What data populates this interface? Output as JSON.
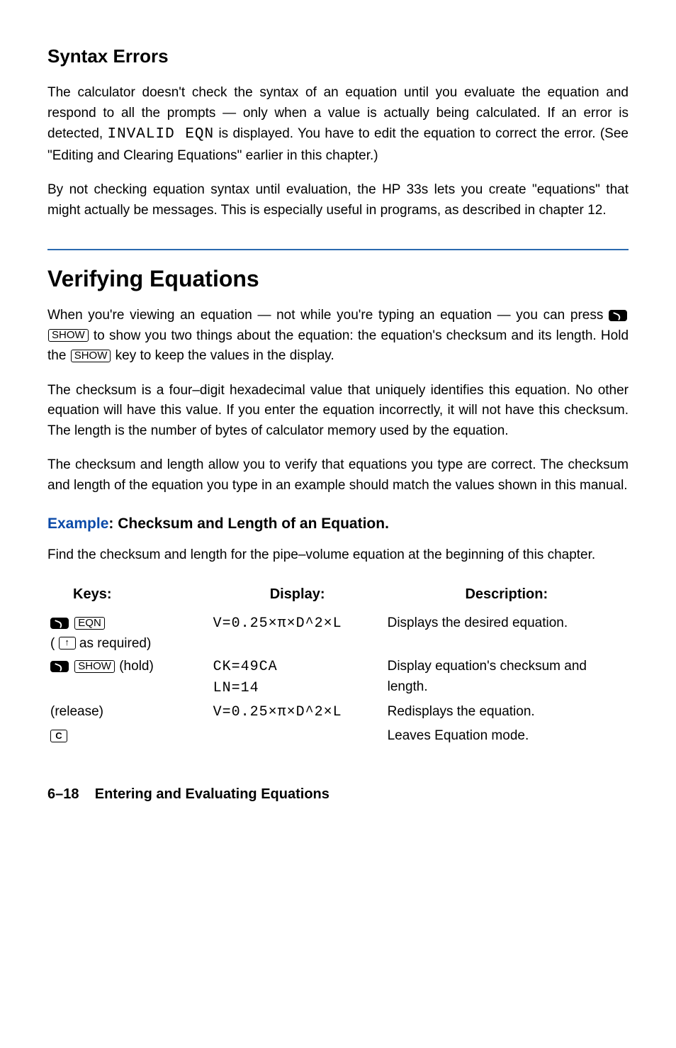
{
  "section1": {
    "title": "Syntax Errors",
    "p1_a": "The calculator doesn't check the syntax of an equation until you evaluate the equation and respond to all the prompts — only when a value is actually being calculated. If an error is detected, ",
    "p1_code": "INVALID EQN",
    "p1_b": " is displayed. You have to edit the equation to correct the error. (See \"Editing and Clearing Equations\" earlier in this chapter.)",
    "p2": "By not checking equation syntax until evaluation, the HP 33s lets you create \"equations\" that might actually be messages. This is especially useful in programs, as described in chapter 12."
  },
  "section2": {
    "title": "Verifying Equations",
    "p1_a": "When you're viewing an equation — not while you're typing an equation — you can press ",
    "show_label": "SHOW",
    "p1_b": " to show you two things about the equation: the equation's checksum and its length. Hold the ",
    "p1_c": " key to keep the values in the display.",
    "p2": "The checksum is a four–digit hexadecimal value that uniquely identifies this equation. No other equation will have this value. If you enter the equation incorrectly, it will not have this checksum. The length is the number of bytes of calculator memory used by the equation.",
    "p3": "The checksum and length allow you to verify that equations you type are correct. The checksum and length of the equation you type in an example should match the values shown in this manual."
  },
  "example": {
    "lead": "Example",
    "title": ": Checksum and Length of an Equation.",
    "intro": "Find the checksum and length for the pipe–volume equation at the beginning of this chapter.",
    "headers": {
      "keys": "Keys:",
      "display": "Display:",
      "desc": "Description:"
    },
    "eqn_label": "EQN",
    "show_label": "SHOW",
    "rows": [
      {
        "keys_suffix": " as required)",
        "display": "V=0.25×π×D^2×L",
        "desc": "Displays the desired equation."
      },
      {
        "keys_suffix": "  (hold)",
        "display1": "CK=49CA",
        "display2": "LN=14",
        "desc": "Display equation's checksum and length."
      },
      {
        "keys_text": "(release)",
        "display": "V=0.25×π×D^2×L",
        "desc": "Redisplays the equation."
      },
      {
        "c_label": "C",
        "desc": "Leaves Equation mode."
      }
    ]
  },
  "footer": {
    "pagenum": "6–18",
    "title": "Entering and Evaluating Equations"
  }
}
